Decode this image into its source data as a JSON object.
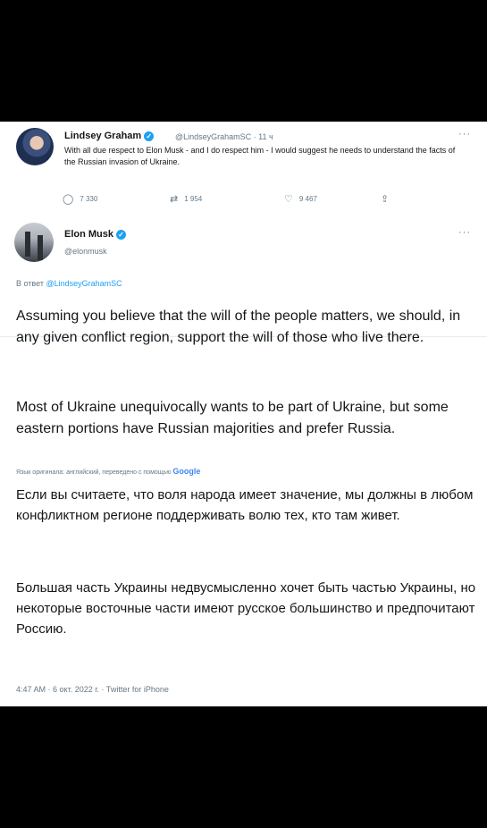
{
  "tweet1": {
    "name": "Lindsey Graham",
    "handle_time": "@LindseyGrahamSC · 11 ч",
    "text": "With all due respect to Elon Musk - and I do respect him - I would suggest he needs to understand the facts of the Russian invasion of Ukraine.",
    "replies": "7 330",
    "retweets": "1 954",
    "likes": "9 467",
    "more": "···"
  },
  "tweet2": {
    "name": "Elon Musk",
    "handle": "@elonmusk",
    "more": "···",
    "reply_prefix": "В ответ ",
    "reply_handle": "@LindseyGrahamSC",
    "para1": "Assuming you believe that the will of the people matters, we should, in any given conflict region, support the will of those who live there.",
    "para2": "Most of Ukraine unequivocally wants to be part of Ukraine, but some eastern portions have Russian majorities and prefer Russia.",
    "translation_note": "Язык оригинала: английский, переведено с помощью",
    "google": "Google",
    "ru1": "Если вы считаете, что воля народа имеет значение, мы должны в любом конфликтном регионе поддерживать волю тех, кто там живет.",
    "ru2": "Большая часть Украины недвусмысленно хочет быть частью Украины, но некоторые восточные части имеют русское большинство и предпочитают Россию.",
    "footer": "4:47 AM · 6 окт. 2022 г. · Twitter for iPhone"
  },
  "icons": {
    "reply": "reply-icon",
    "retweet": "retweet-icon",
    "like": "heart-icon",
    "share": "share-icon",
    "verified": "verified-badge-icon"
  },
  "colors": {
    "accent": "#1da1f2",
    "text": "#14171a",
    "muted": "#657786"
  }
}
